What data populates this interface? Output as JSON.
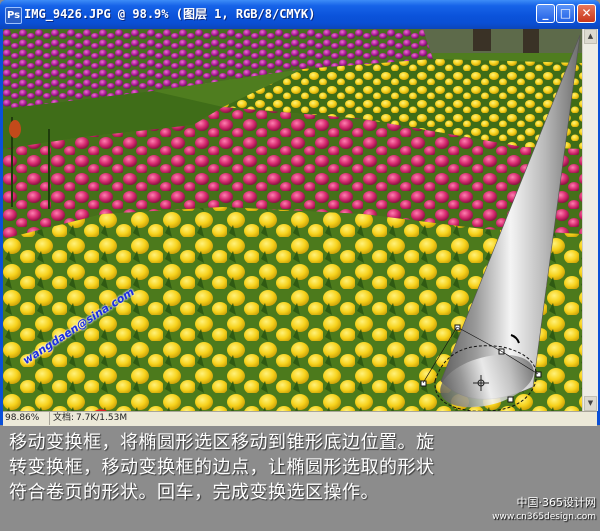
{
  "window": {
    "title": "IMG_9426.JPG @ 98.9% (图层 1, RGB/8/CMYK)",
    "app_icon": "Ps",
    "controls": {
      "minimize": "_",
      "maximize": "□",
      "close": "✕"
    }
  },
  "statusbar": {
    "zoom": "98.86%",
    "doc_label": "文档:",
    "doc_size": "7.7K/1.53M"
  },
  "caption": {
    "line1": "移动变换框，将椭圆形选区移动到锥形底边位置。旋",
    "line2": "转变换框，移动变换框的边点，让椭圆形选取的形状",
    "line3": "符合卷页的形状。回车，完成变换选区操作。"
  },
  "site_mark": {
    "name": "中国·365设计网",
    "url": "www.cn365design.com"
  },
  "watermark": {
    "text": "wangdaen@sina.com"
  },
  "icons": [
    "photoshop-app-icon",
    "minimize-icon",
    "maximize-icon",
    "close-icon",
    "transform-center-crosshair-icon",
    "scroll-up-arrow-icon",
    "scroll-down-arrow-icon"
  ],
  "colors": {
    "titlebar": "#0a50d8",
    "close_button": "#c8361b",
    "caption_background": "#8c8c8c",
    "tulip_yellow": "#f7d21c",
    "tulip_pink": "#d42a6e"
  }
}
